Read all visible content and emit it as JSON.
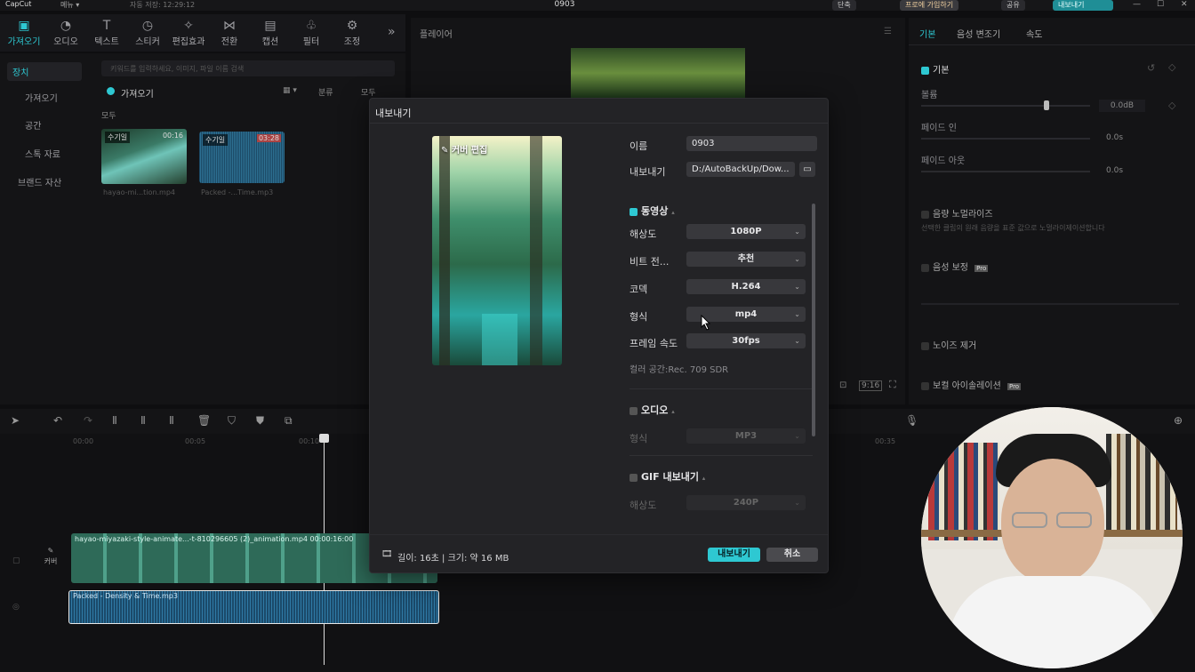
{
  "titlebar": {
    "app_name": "CapCut",
    "menu": "메뉴 ▾",
    "autosave": "자동 저장: 12:29:12",
    "project_name": "0903",
    "shortcut": "단축",
    "pro_join": "프로에 가입하기",
    "share": "공유",
    "export": "내보내기"
  },
  "toolbar": {
    "tools": [
      {
        "label": "가져오기",
        "icon": "import-icon"
      },
      {
        "label": "오디오",
        "icon": "audio-icon"
      },
      {
        "label": "텍스트",
        "icon": "text-icon"
      },
      {
        "label": "스티커",
        "icon": "sticker-icon"
      },
      {
        "label": "편집효과",
        "icon": "effects-icon"
      },
      {
        "label": "전환",
        "icon": "transition-icon"
      },
      {
        "label": "캡션",
        "icon": "captions-icon"
      },
      {
        "label": "필터",
        "icon": "filter-icon"
      },
      {
        "label": "조정",
        "icon": "adjust-icon"
      }
    ],
    "more": "»"
  },
  "sidenav": {
    "items": [
      "장치",
      "가져오기",
      "공간",
      "스톡 자료",
      "브랜드 자산"
    ]
  },
  "media": {
    "search_placeholder": "키워드를 입력하세요, 이미지, 파일 이름 검색",
    "import_label": "가져오기",
    "sort_label": "분류",
    "filter_label": "모두",
    "all_label": "모두",
    "items": [
      {
        "badge": "수기일",
        "duration": "00:16",
        "name": "hayao-mi...tion.mp4"
      },
      {
        "badge": "수기일",
        "duration": "03:28",
        "name": "Packed -...Time.mp3"
      }
    ]
  },
  "player": {
    "title": "플레이어",
    "ratio": "9:16"
  },
  "inspector": {
    "tabs": [
      "기본",
      "음성 변조기",
      "속도"
    ],
    "section_basic": "기본",
    "volume_label": "볼륨",
    "volume_value": "0.0dB",
    "fade_in_label": "페이드 인",
    "fade_in_value": "0.0s",
    "fade_out_label": "페이드 아웃",
    "fade_out_value": "0.0s",
    "normalize_label": "음량 노멀라이즈",
    "normalize_desc": "선택한 클립의 원래 음량을 표준 값으로 노멀라이제이션합니다",
    "enhance_label": "음성 보정",
    "noise_label": "노이즈 제거",
    "vocal_label": "보컬 아이솔레이션",
    "pro_badge": "Pro"
  },
  "timeline": {
    "ticks": [
      "00:00",
      "00:05",
      "00:10",
      "00:35"
    ],
    "video_clip": "hayao-miyazaki-style-animate...-t-810296605 (2)_animation.mp4   00:00:16:00",
    "audio_clip": "Packed - Density & Time.mp3",
    "cover_label": "커버"
  },
  "dialog": {
    "title": "내보내기",
    "cover_edit": "커버 편집",
    "name_label": "이름",
    "name_value": "0903",
    "path_label": "내보내기",
    "path_value": "D:/AutoBackUp/Dow...",
    "video_section": "동영상",
    "resolution_label": "해상도",
    "resolution_value": "1080P",
    "bitrate_label": "비트 전...",
    "bitrate_value": "추천",
    "codec_label": "코덱",
    "codec_value": "H.264",
    "format_label": "형식",
    "format_value": "mp4",
    "fps_label": "프레임 속도",
    "fps_value": "30fps",
    "color_space": "컬러 공간:Rec. 709 SDR",
    "audio_section": "오디오",
    "audio_format_label": "형식",
    "audio_format_value": "MP3",
    "gif_section": "GIF 내보내기",
    "gif_res_label": "해상도",
    "gif_res_value": "240P",
    "footer_info": "길이: 16초 | 크기: 약 16 MB",
    "export_button": "내보내기",
    "cancel_button": "취소"
  },
  "colors": {
    "accent": "#2ec8d2",
    "dialog_bg": "#232326",
    "panel_bg": "#141416"
  }
}
